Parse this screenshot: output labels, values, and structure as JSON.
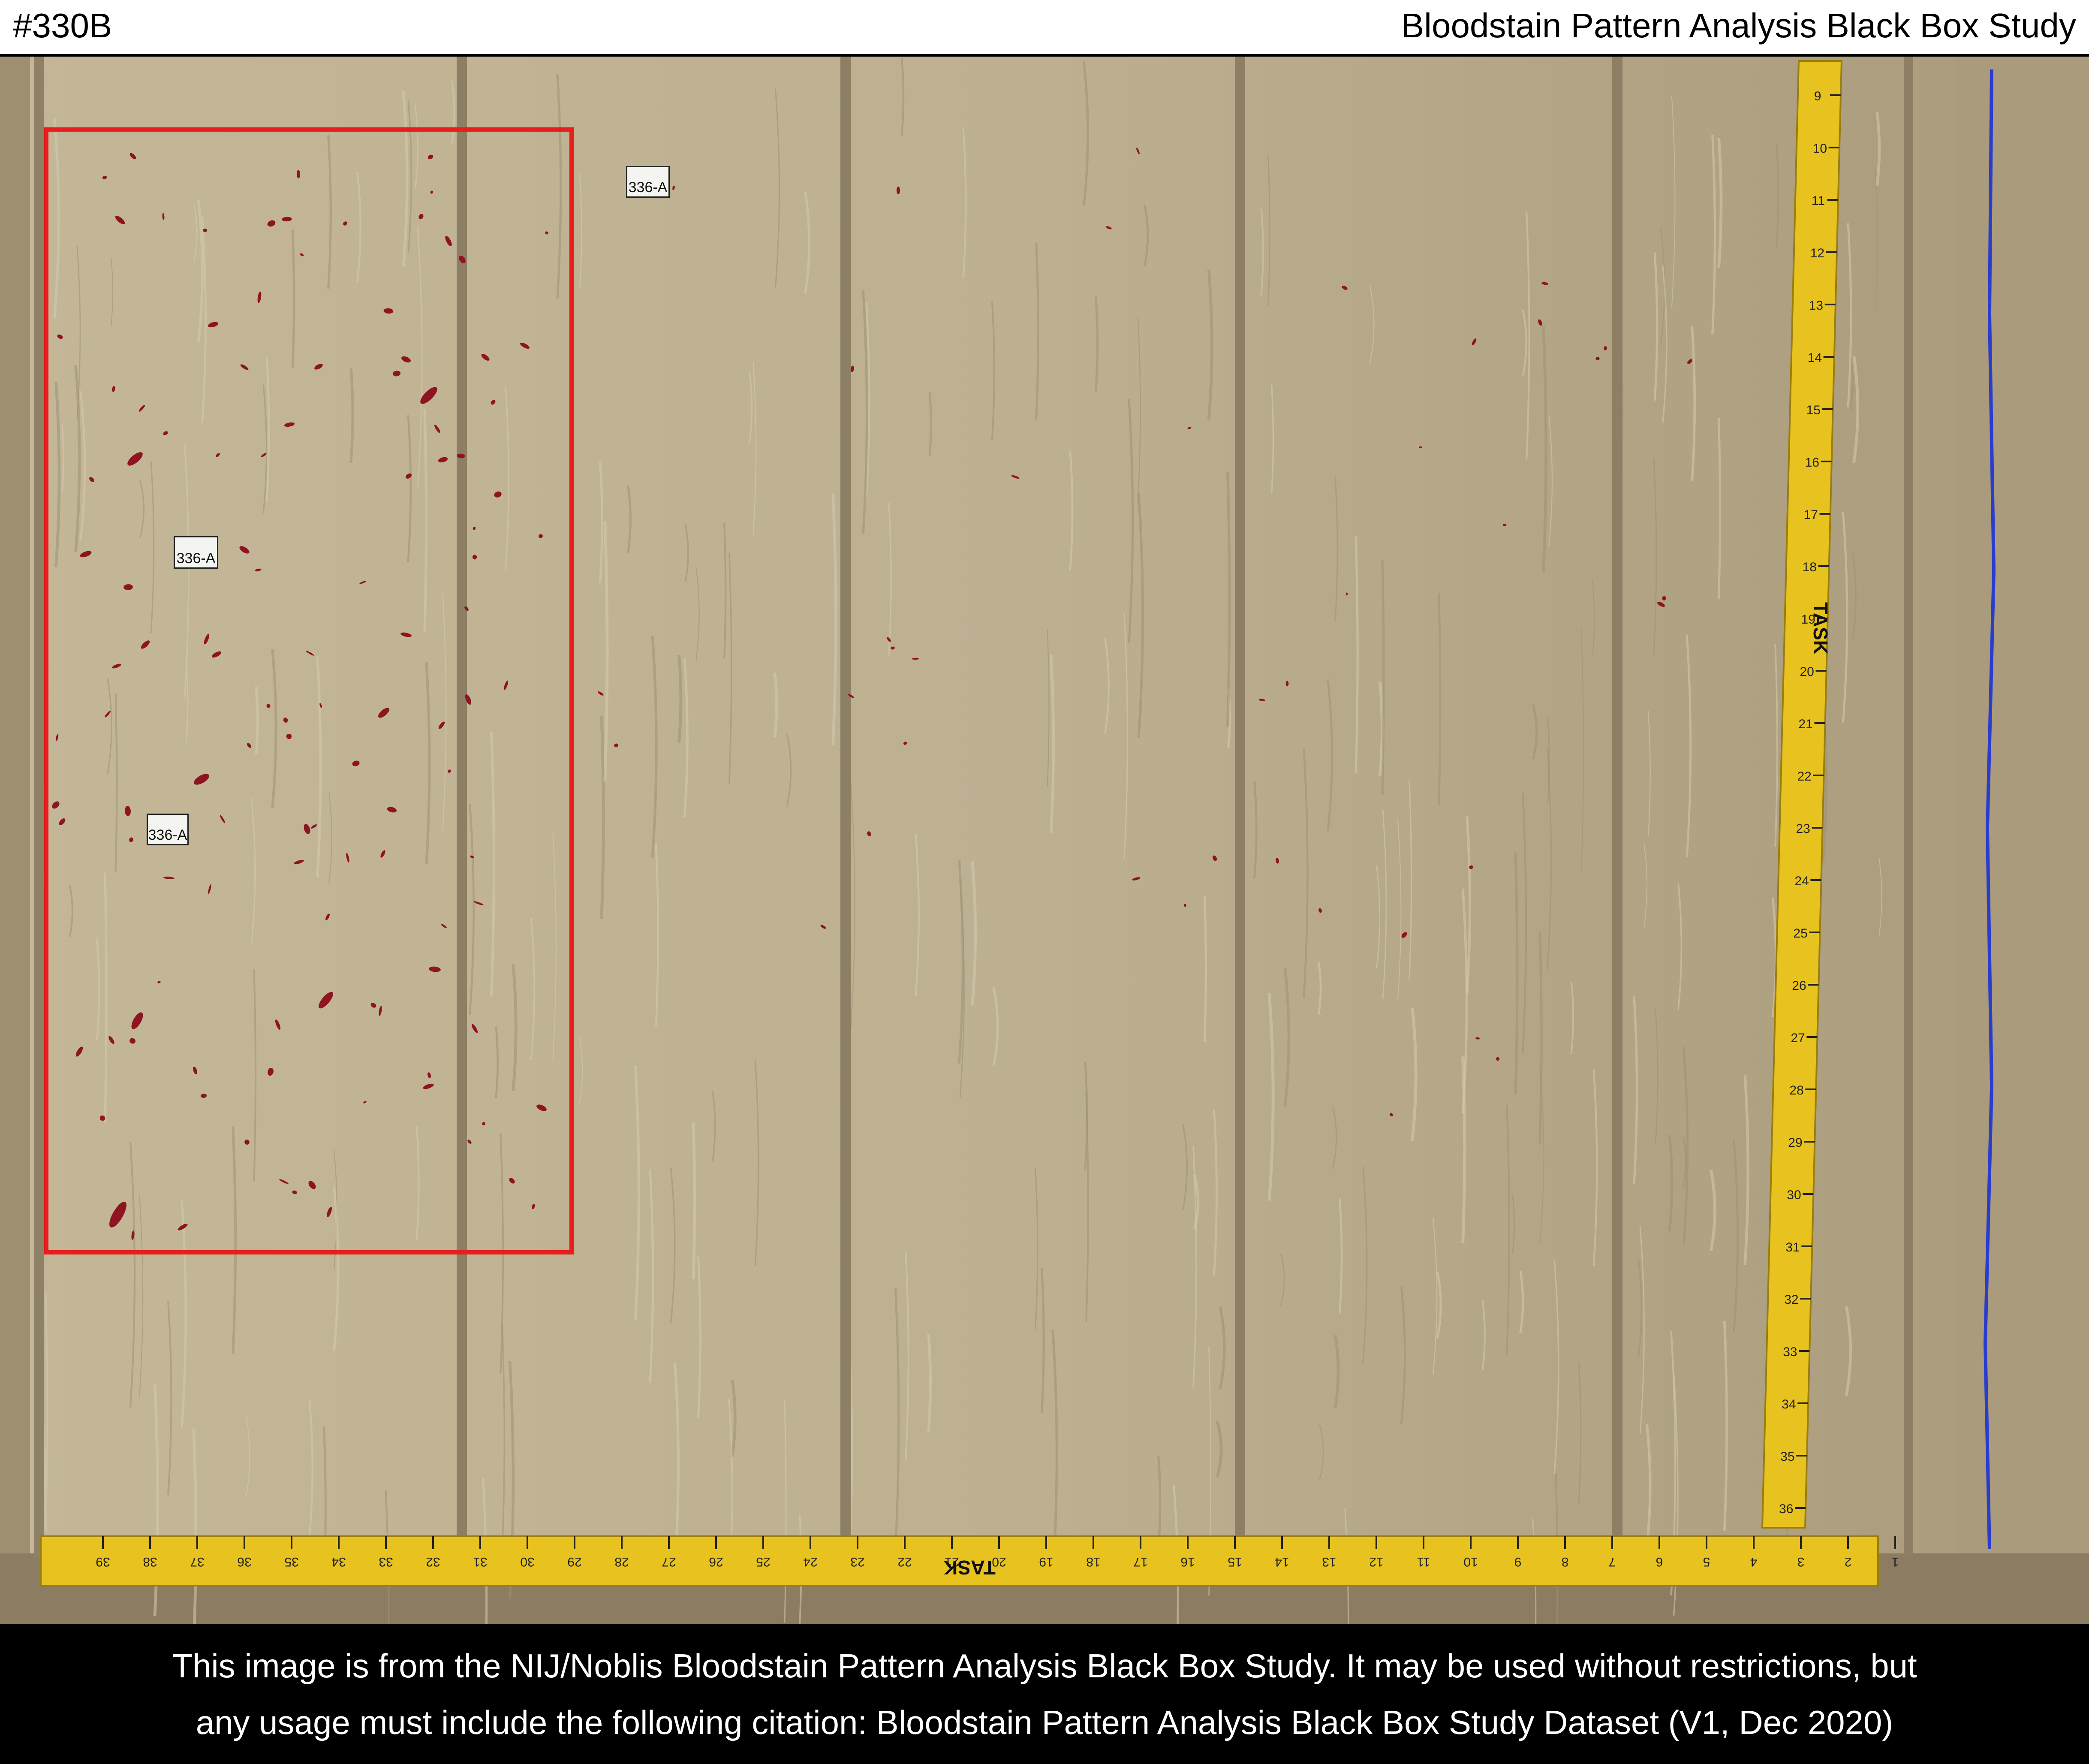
{
  "header": {
    "id_label": "#330B",
    "title": "Bloodstain Pattern Analysis Black Box Study"
  },
  "evidence_tags": [
    "336-A",
    "336-A",
    "336-A"
  ],
  "tapes": {
    "vertical_brand": "TASK",
    "horizontal_brand": "TASK",
    "vertical_numbers": [
      "9",
      "10",
      "11",
      "12",
      "13",
      "14",
      "15",
      "16",
      "17",
      "18",
      "19",
      "20",
      "21",
      "22",
      "23",
      "24",
      "25",
      "26",
      "27",
      "28",
      "29",
      "30",
      "31",
      "32",
      "33",
      "34",
      "35",
      "36"
    ],
    "horizontal_numbers": [
      "39",
      "38",
      "37",
      "36",
      "35",
      "34",
      "33",
      "32",
      "31",
      "30",
      "29",
      "28",
      "27",
      "26",
      "25",
      "24",
      "23",
      "22",
      "21",
      "20",
      "19",
      "18",
      "17",
      "16",
      "15",
      "14",
      "13",
      "12",
      "11",
      "10",
      "9",
      "8",
      "7",
      "6",
      "5",
      "4",
      "3",
      "2",
      "1"
    ]
  },
  "colors": {
    "wall": "#b9ab8c",
    "tape": "#e8c21e",
    "annotation_box": "#e61e1e",
    "stain": "#8e1422",
    "blue_line": "#2a3ccc"
  },
  "footer": {
    "line1": "This image is from the NIJ/Noblis Bloodstain Pattern Analysis Black Box Study. It may be used without restrictions, but",
    "line2": "any usage must include the following citation:  Bloodstain Pattern Analysis Black Box Study Dataset (V1, Dec 2020)"
  }
}
